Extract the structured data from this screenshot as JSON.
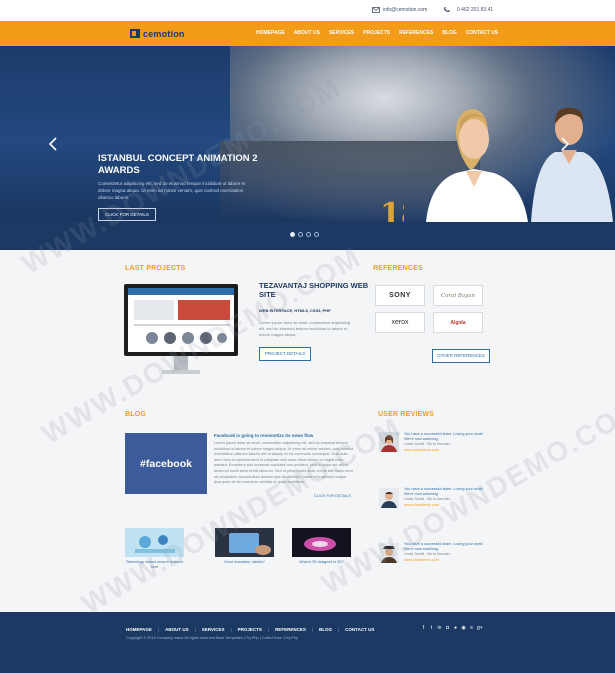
{
  "topbar": {
    "email": "info@cemotion.com",
    "phone": "0 462 201 83 41"
  },
  "brand": {
    "name": "cemotion",
    "accent": "#f39c1a",
    "navy": "#1d3a66"
  },
  "nav": {
    "items": [
      "HOMEPAGE",
      "ABOUT US",
      "SERVICES",
      "PROJECTS",
      "REFERENCES",
      "BLOG",
      "CONTACT US"
    ]
  },
  "hero": {
    "title": "ISTANBUL CONCEPT ANIMATION 2 AWARDS",
    "text": "Consectetur adipisicing elit, sed do eiusmod tempor incididunt ut labore et dolore magna aliqua. Ut enim ad minim veniam, quis nostrud exercitation ullamco laboris.",
    "button": "CLICK FOR DETAILS",
    "slides": 4,
    "active_slide": 1
  },
  "projects": {
    "heading": "LAST PROJECTS",
    "title": "TEZAVANTAJ SHOPPING WEB SITE",
    "subtitle": "WEB INTERFACE, HTML5, CSS3, PHP",
    "description": "Lorem ipsum dolor sit amet, consectetur adipisicing elit, sed do eiusmod tempor incididunt ut labore et dolore magna aliqua.",
    "button": "PROJECT DETAILS"
  },
  "references": {
    "heading": "REFERENCES",
    "logos": [
      "SONY",
      "Coral Bayan",
      "xerox",
      "Algida"
    ],
    "button": "OTHER REFERENCES"
  },
  "blog": {
    "heading": "BLOG",
    "feature_image": "#facebook",
    "title": "Facebook is going to remonetize its news flow",
    "text": "Lorem ipsum dolor sit amet, consectetur adipisicing elit, sed do eiusmod tempor incididunt ut labore et dolore magna aliqua. Ut enim ad minim veniam, quis nostrud exercitation ullamco laboris nisi ut aliquip ex ea commodo consequat. Duis aute irure dolor in reprehenderit in voluptate velit esse cillum dolore eu fugiat nulla pariatur. Excepteur sint occaecat cupidatat non proident, sunt in culpa qui officia deserunt mollit anim id est laborum. Sed ut perspiciatis unde omnis iste natus error sit voluptatem accusantium doloremque laudantium, totam rem aperiam eaque ipsa quae ab illo inventore veritatis et quasi architecto.",
    "more": "CLICK FOR DETAILS",
    "posts": [
      {
        "caption": "Technology related news in features here"
      },
      {
        "caption": "Good innovation, tablets?"
      },
      {
        "caption": "What is 3D designed to 3D?"
      }
    ]
  },
  "reviews": {
    "heading": "USER REVIEWS",
    "items": [
      {
        "text": "You have a successful team. Loving your work! We're now watching.",
        "name": "Linda Swaft - Be to founder",
        "link": "www.cloerdemo.com"
      },
      {
        "text": "You have a successful team. Loving your work! We're now watching.",
        "name": "Linda Swaft - Be to founder",
        "link": "www.cloerdemo.com"
      },
      {
        "text": "You have a successful team. Loving your work! We're now watching.",
        "name": "Linda Swaft - Be to founder",
        "link": "www.cloerdemo.com"
      }
    ]
  },
  "footer": {
    "nav": [
      "HOMEPAGE",
      "ABOUT US",
      "SERVICES",
      "PROJECTS",
      "REFERENCES",
      "BLOG",
      "CONTACT US"
    ],
    "copyright": "Copyright © 2014 Company name All rights reserved.More Templates 17ry.Php   |   Collect from 17ry.Php",
    "social": [
      "facebook-icon",
      "twitter-icon",
      "linkedin-icon",
      "instagram-icon",
      "flickr-icon",
      "rss-icon",
      "skype-icon",
      "googleplus-icon"
    ]
  },
  "watermark": "WWW.DOWNDEMO.COM"
}
